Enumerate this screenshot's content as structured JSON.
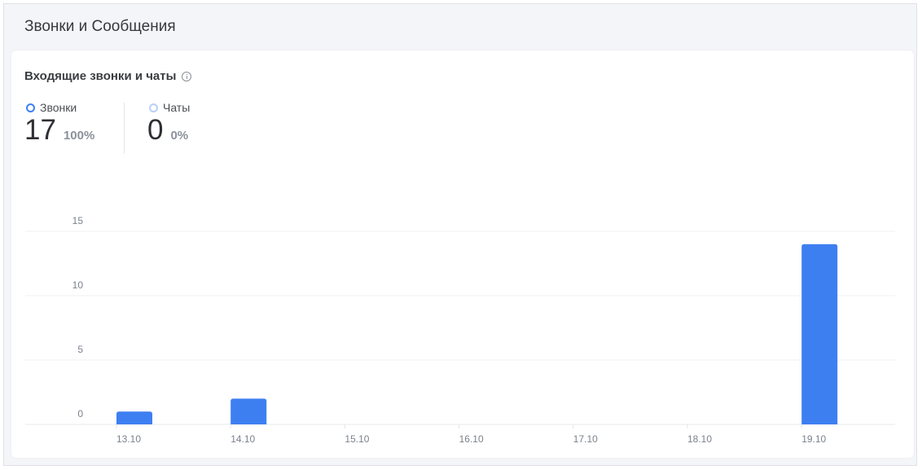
{
  "section": {
    "title": "Звонки и Сообщения"
  },
  "card": {
    "title": "Входящие звонки и чаты",
    "info_icon": "info-icon"
  },
  "stats": [
    {
      "label": "Звонки",
      "value": "17",
      "percent": "100%",
      "color": "#3d7ff1"
    },
    {
      "label": "Чаты",
      "value": "0",
      "percent": "0%",
      "color": "#b9d0f7"
    }
  ],
  "chart_data": {
    "type": "bar",
    "categories": [
      "13.10",
      "14.10",
      "15.10",
      "16.10",
      "17.10",
      "18.10",
      "19.10"
    ],
    "series": [
      {
        "values": [
          1,
          2,
          0,
          0,
          0,
          0,
          14
        ],
        "color": "#3d7ff1"
      }
    ],
    "yticks": [
      "0",
      "5",
      "10",
      "15"
    ],
    "ylim": [
      0,
      15
    ],
    "grid": true
  }
}
